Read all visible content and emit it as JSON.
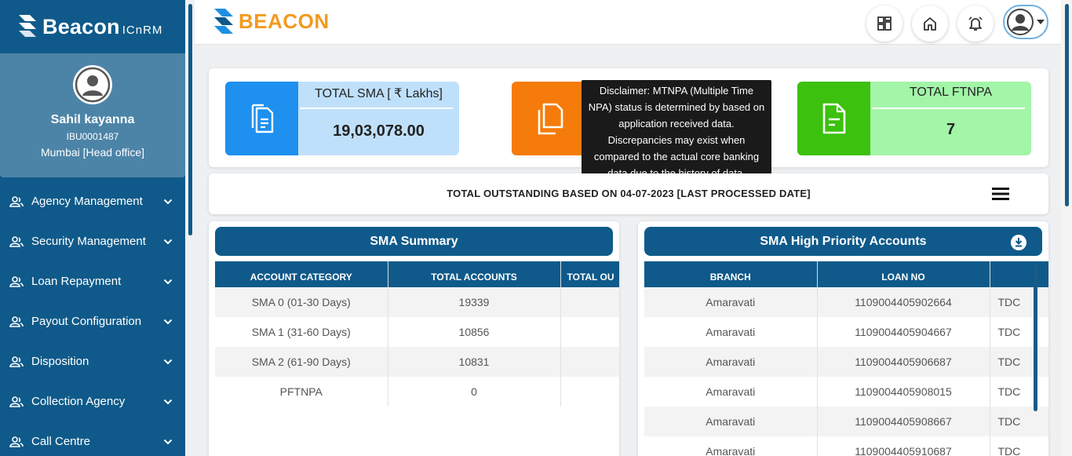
{
  "sidebar": {
    "brand": "Beacon",
    "brand_sub": "ICnRM",
    "user": {
      "name": "Sahil kayanna",
      "id": "IBU0001487",
      "office": "Mumbai [Head office]"
    },
    "items": [
      {
        "label": "Agency Management"
      },
      {
        "label": "Security Management"
      },
      {
        "label": "Loan Repayment"
      },
      {
        "label": "Payout Configuration"
      },
      {
        "label": "Disposition"
      },
      {
        "label": "Collection Agency"
      },
      {
        "label": "Call Centre"
      }
    ]
  },
  "header": {
    "brand": "BEACON",
    "icons": [
      "dashboard-icon",
      "home-icon",
      "bell-icon",
      "user-avatar-icon"
    ]
  },
  "cards": {
    "sma": {
      "title": "TOTAL SMA [ ₹ Lakhs]",
      "value": "19,03,078.00"
    },
    "ftnpa": {
      "title": "TOTAL FTNPA",
      "value": "7"
    }
  },
  "tooltip": {
    "lines": [
      "Disclaimer: MTNPA (Multiple Time",
      "NPA) status is determined by based on",
      "application received data.",
      "Discrepancies may exist when",
      "compared to the actual core banking",
      "data due to the history of data."
    ]
  },
  "outstanding": {
    "text": "TOTAL OUTSTANDING BASED ON 04-07-2023 [LAST PROCESSED DATE]"
  },
  "sma_summary": {
    "title": "SMA Summary",
    "columns": [
      "ACCOUNT CATEGORY",
      "TOTAL ACCOUNTS",
      "TOTAL OU"
    ],
    "rows": [
      [
        "SMA 0 (01-30 Days)",
        "19339",
        ""
      ],
      [
        "SMA 1 (31-60 Days)",
        "10856",
        ""
      ],
      [
        "SMA 2 (61-90 Days)",
        "10831",
        ""
      ],
      [
        "PFTNPA",
        "0",
        ""
      ]
    ]
  },
  "high_priority": {
    "title": "SMA High Priority Accounts",
    "columns": [
      "BRANCH",
      "LOAN NO",
      ""
    ],
    "rows": [
      [
        "Amaravati",
        "1109004405902664",
        "TDC"
      ],
      [
        "Amaravati",
        "1109004405904667",
        "TDC"
      ],
      [
        "Amaravati",
        "1109004405906687",
        "TDC"
      ],
      [
        "Amaravati",
        "1109004405908015",
        "TDC"
      ],
      [
        "Amaravati",
        "1109004405908667",
        "TDC"
      ],
      [
        "Amaravati",
        "1109004405910687",
        "TDC"
      ]
    ]
  },
  "colors": {
    "primary": "#0f5a8a",
    "profile_bg": "#4c84a8",
    "sma_card": "#1e90ef",
    "sma_card_light": "#bfe0fb",
    "orange_card": "#f57c0a",
    "green_card": "#3cc10e",
    "green_card_light": "#a3f5a8",
    "brand_orange": "#f39a1f"
  }
}
